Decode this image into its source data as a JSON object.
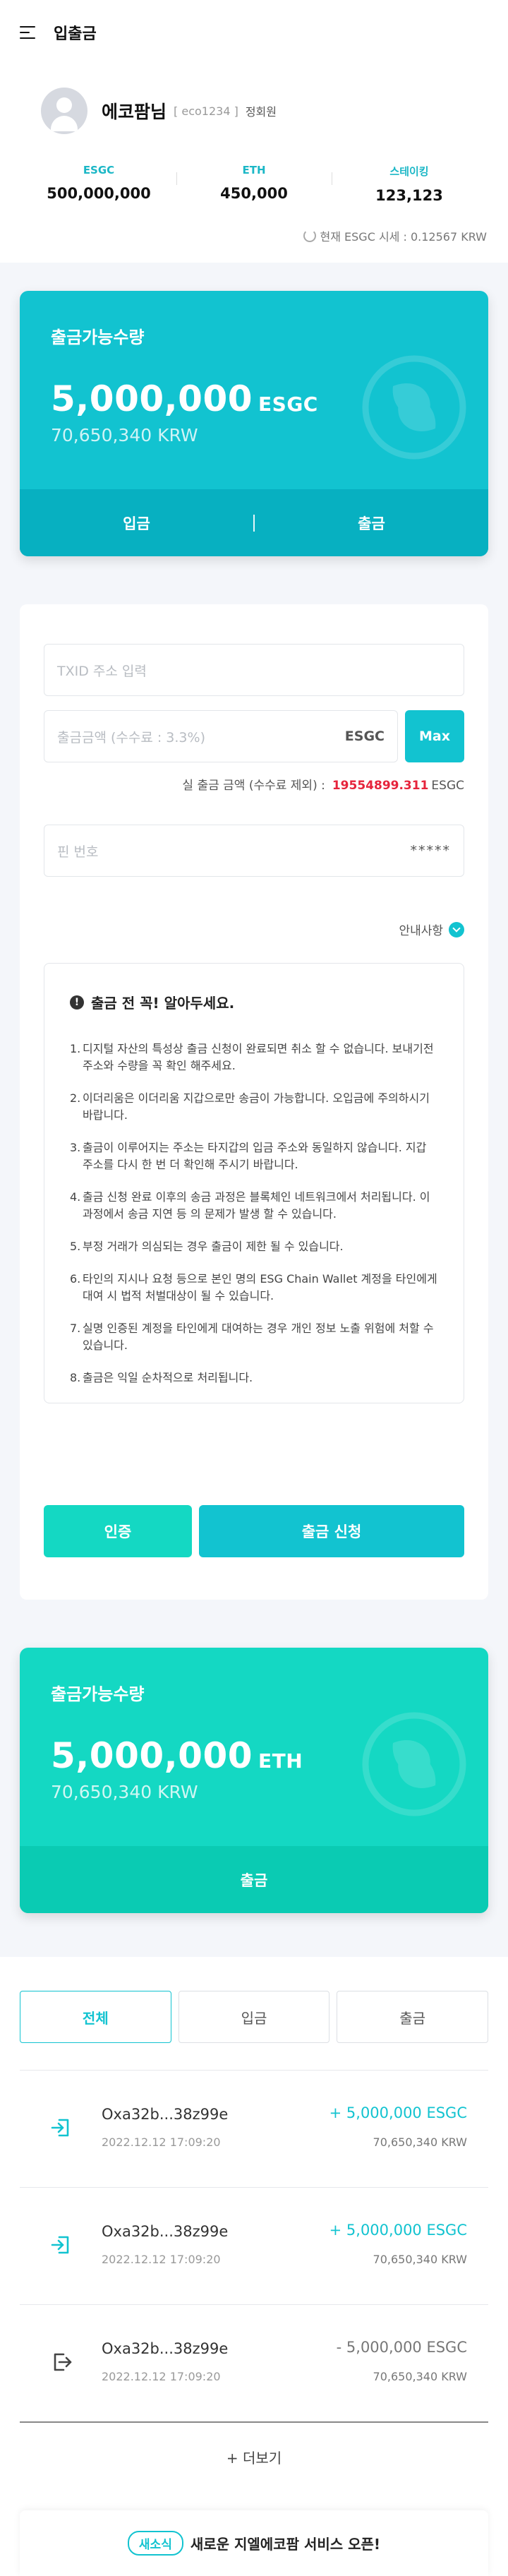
{
  "header": {
    "title": "입출금",
    "menu_icon": "hamburger-menu-icon"
  },
  "profile": {
    "nickname": "에코팜님",
    "user_id": "[ eco1234 ]",
    "grade": "정회원"
  },
  "balances": [
    {
      "label": "ESGC",
      "value": "500,000,000"
    },
    {
      "label": "ETH",
      "value": "450,000"
    },
    {
      "label": "스테이킹",
      "value": "123,123"
    }
  ],
  "rate_text": "현재 ESGC 시세 : 0.12567 KRW",
  "esgc_card": {
    "label": "출금가능수량",
    "amount": "5,000,000",
    "unit": "ESGC",
    "krw": "70,650,340 KRW",
    "deposit_label": "입금",
    "withdraw_label": "출금"
  },
  "form": {
    "txid_placeholder": "TXID 주소 입력",
    "amount_placeholder": "출금금액 (수수료 : 3.3%)",
    "amount_unit": "ESGC",
    "max_label": "Max",
    "net_label": "실 출금 금액 (수수료 제외) :",
    "net_value": "19554899.311",
    "net_unit": "ESGC",
    "pin_placeholder": "핀 번호",
    "pin_value": "*****",
    "guide_label": "안내사항"
  },
  "notice": {
    "title": "출금 전 꼭! 알아두세요.",
    "items": [
      "디지털 자산의 특성상 출금 신청이 완료되면 취소 할 수 없습니다. 보내기전 주소와 수량을 꼭 확인 해주세요.",
      "이더리움은 이더리움 지갑으로만 송금이 가능합니다. 오입금에 주의하시기 바랍니다.",
      "출금이 이루어지는 주소는 타지갑의 입금 주소와 동일하지 않습니다. 지갑 주소를 다시 한 번 더 확인해 주시기 바랍니다.",
      "출금 신청 완료 이후의 송금 과정은 블록체인 네트워크에서 처리됩니다. 이 과정에서 송금 지연 등 의 문제가 발생 할 수 있습니다.",
      "부정 거래가 의심되는 경우 출금이 제한 될 수 있습니다.",
      "타인의 지시나 요청 등으로 본인 명의 ESG Chain Wallet 계정을 타인에게 대여 시 법적 처벌대상이 될 수 있습니다.",
      "실명 인증된 계정을 타인에게 대여하는 경우 개인 정보 노출 위험에 처할 수 있습니다.",
      "출금은 익일 순차적으로 처리됩니다."
    ]
  },
  "buttons": {
    "verify": "인증",
    "submit": "출금 신청"
  },
  "eth_card": {
    "label": "출금가능수량",
    "amount": "5,000,000",
    "unit": "ETH",
    "krw": "70,650,340 KRW",
    "withdraw_label": "출금"
  },
  "tabs": [
    "전체",
    "입금",
    "출금"
  ],
  "transactions": [
    {
      "type": "deposit",
      "address": "Oxa32b...38z99e",
      "date": "2022.12.12 17:09:20",
      "amount": "+ 5,000,000 ESGC",
      "krw": "70,650,340 KRW"
    },
    {
      "type": "deposit",
      "address": "Oxa32b...38z99e",
      "date": "2022.12.12 17:09:20",
      "amount": "+ 5,000,000 ESGC",
      "krw": "70,650,340 KRW"
    },
    {
      "type": "withdraw",
      "address": "Oxa32b...38z99e",
      "date": "2022.12.12 17:09:20",
      "amount": "- 5,000,000 ESGC",
      "krw": "70,650,340 KRW"
    }
  ],
  "more_label": "+ 더보기",
  "news": {
    "badge": "새소식",
    "text": "새로운 지엘에코팜 서비스 오픈!"
  },
  "colors": {
    "primary": "#12c3d0",
    "mint": "#14d8c3",
    "red": "#e6243c"
  }
}
